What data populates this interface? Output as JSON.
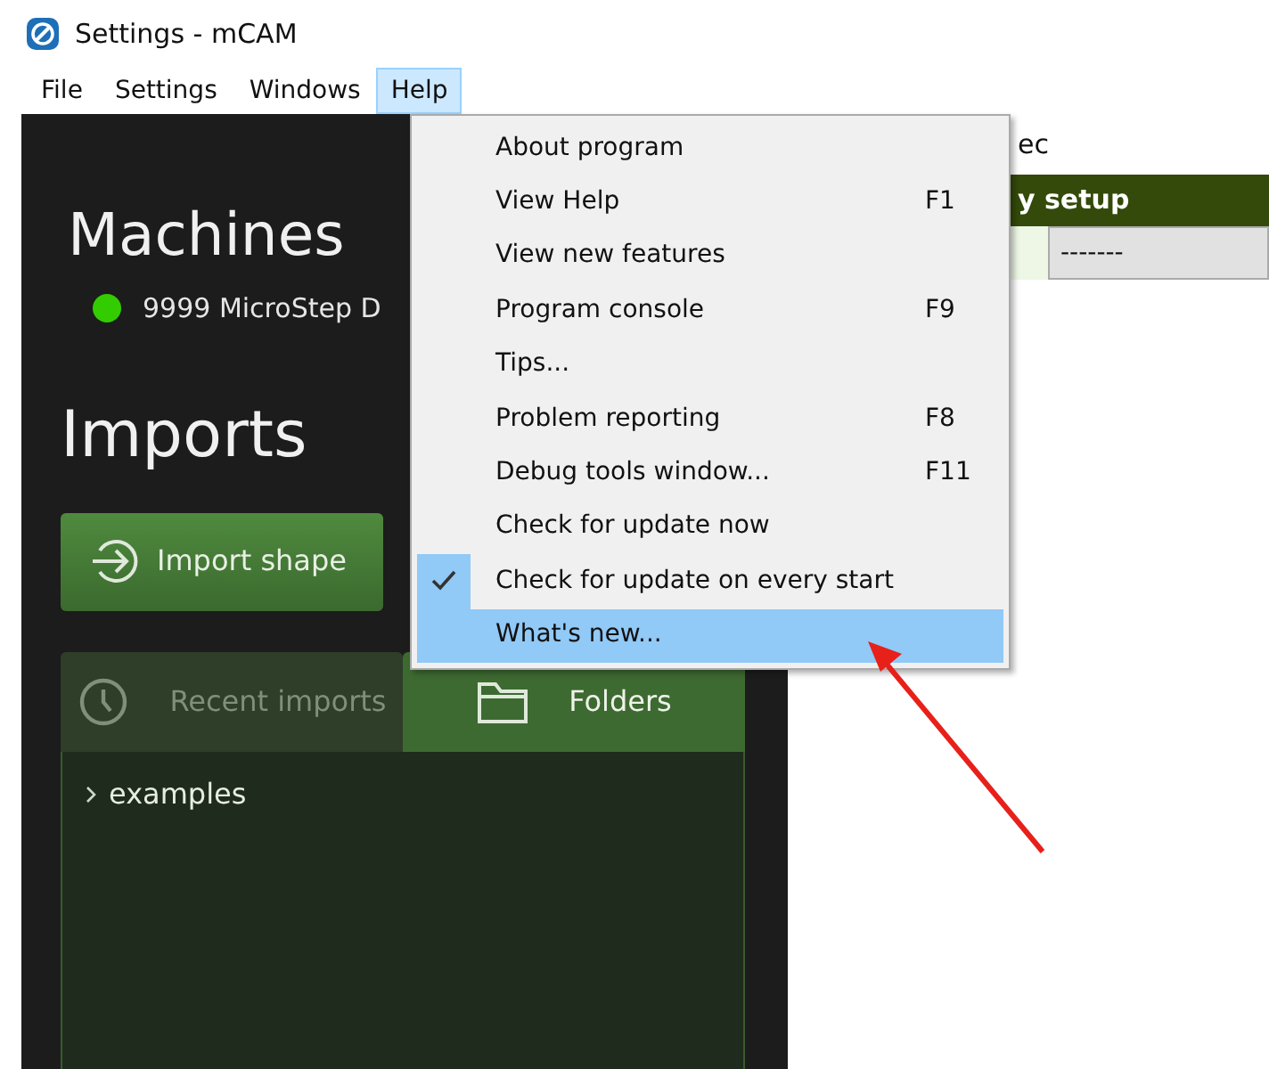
{
  "window": {
    "title": "Settings - mCAM"
  },
  "menu_bar": [
    {
      "label": "File",
      "selected": false
    },
    {
      "label": "Settings",
      "selected": false
    },
    {
      "label": "Windows",
      "selected": false
    },
    {
      "label": "Help",
      "selected": true
    }
  ],
  "sidebar": {
    "machines_title": "Machines",
    "machines": [
      {
        "name": "9999 MicroStep D",
        "color": "#33cc00"
      }
    ],
    "imports_title": "Imports",
    "import_button": "Import shape",
    "tabs": [
      {
        "label": "Recent imports",
        "selected": false,
        "kind": "clock"
      },
      {
        "label": "Folders",
        "selected": true,
        "kind": "folder"
      }
    ],
    "folders": [
      {
        "label": "examples",
        "expanded": false
      }
    ]
  },
  "main": {
    "field_text": "ec",
    "section_header": "y setup",
    "dropdown_value": "-------"
  },
  "help_menu": [
    {
      "label": "About program",
      "checked": false,
      "selected": false
    },
    {
      "label": "View Help",
      "shortcut": "F1",
      "checked": false,
      "selected": false
    },
    {
      "label": "View new features",
      "checked": false,
      "selected": false
    },
    {
      "label": "Program console",
      "shortcut": "F9",
      "checked": false,
      "selected": false
    },
    {
      "label": "Tips...",
      "checked": false,
      "selected": false
    },
    {
      "label": "Problem reporting",
      "shortcut": "F8",
      "checked": false,
      "selected": false
    },
    {
      "label": "Debug tools window...",
      "shortcut": "F11",
      "checked": false,
      "selected": false
    },
    {
      "label": "Check for update now",
      "checked": false,
      "selected": false
    },
    {
      "label": "Check for update on every start",
      "checked": true,
      "selected": false
    },
    {
      "label": "What's new...",
      "checked": false,
      "selected": true
    }
  ]
}
